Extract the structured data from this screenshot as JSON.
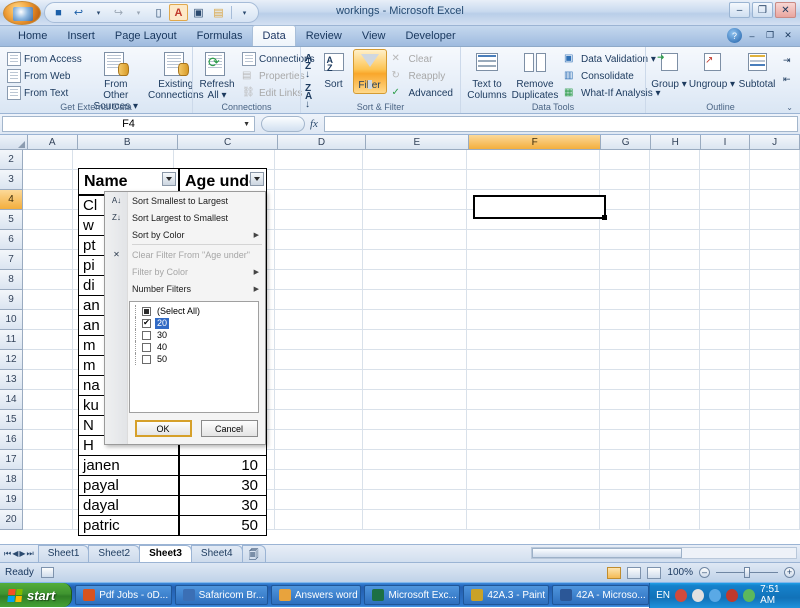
{
  "window": {
    "title": "workings - Microsoft Excel",
    "minimize": "–",
    "restore": "❐",
    "close": "✕",
    "help": "?"
  },
  "quick_access": {
    "office_button": "office-button",
    "items": [
      {
        "name": "save",
        "glyph": "💾"
      },
      {
        "name": "undo",
        "glyph": "↩"
      },
      {
        "name": "redo",
        "glyph": "↪"
      },
      {
        "name": "new",
        "glyph": "🗋"
      },
      {
        "name": "font-color",
        "glyph": "A"
      },
      {
        "name": "print-preview",
        "glyph": "🔍"
      },
      {
        "name": "open",
        "glyph": "📂"
      },
      {
        "name": "customize",
        "glyph": "▾"
      }
    ]
  },
  "ribbon": {
    "tabs": [
      {
        "label": "Home",
        "active": false
      },
      {
        "label": "Insert",
        "active": false
      },
      {
        "label": "Page Layout",
        "active": false
      },
      {
        "label": "Formulas",
        "active": false
      },
      {
        "label": "Data",
        "active": true
      },
      {
        "label": "Review",
        "active": false
      },
      {
        "label": "View",
        "active": false
      },
      {
        "label": "Developer",
        "active": false
      }
    ],
    "groups": [
      {
        "label": "Get External Data",
        "small_items": [
          "From Access",
          "From Web",
          "From Text"
        ],
        "big_items": [
          "From Other Sources ▾",
          "Existing Connections"
        ]
      },
      {
        "label": "Connections",
        "big_items": [
          "Refresh All ▾"
        ],
        "small_items": [
          "Connections",
          "Properties",
          "Edit Links"
        ]
      },
      {
        "label": "Sort & Filter",
        "big_items": [
          "Sort",
          "Filter"
        ],
        "small_items": [
          "Clear",
          "Reapply",
          "Advanced"
        ],
        "sort_az": "A Z",
        "sort_za": "Z A"
      },
      {
        "label": "Data Tools",
        "big_items": [
          "Text to Columns",
          "Remove Duplicates"
        ],
        "small_items": [
          "Data Validation ▾",
          "Consolidate",
          "What-If Analysis ▾"
        ]
      },
      {
        "label": "Outline",
        "big_items": [
          "Group ▾",
          "Ungroup ▾",
          "Subtotal"
        ]
      }
    ]
  },
  "formula_bar": {
    "name_box": "F4",
    "fx_label": "fx",
    "formula": ""
  },
  "grid": {
    "columns": [
      "A",
      "B",
      "C",
      "D",
      "E",
      "F",
      "G",
      "H",
      "I",
      "J"
    ],
    "selected_column": "F",
    "rows": [
      "2",
      "3",
      "4",
      "5",
      "6",
      "7",
      "8",
      "9",
      "10",
      "11",
      "12",
      "13",
      "14",
      "15",
      "16",
      "17",
      "18",
      "19",
      "20"
    ],
    "selected_row": "4",
    "active_cell": "F4",
    "table": {
      "headers": [
        "Name",
        "Age under"
      ],
      "rows": [
        {
          "name": "Cl",
          "age": ""
        },
        {
          "name": "w",
          "age": ""
        },
        {
          "name": "pt",
          "age": ""
        },
        {
          "name": "pi",
          "age": ""
        },
        {
          "name": "di",
          "age": ""
        },
        {
          "name": "an",
          "age": ""
        },
        {
          "name": "an",
          "age": ""
        },
        {
          "name": "m",
          "age": ""
        },
        {
          "name": "m",
          "age": ""
        },
        {
          "name": "na",
          "age": ""
        },
        {
          "name": "ku",
          "age": ""
        },
        {
          "name": "N",
          "age": ""
        },
        {
          "name": "H",
          "age": ""
        },
        {
          "name": "janen",
          "age": "10"
        },
        {
          "name": "payal",
          "age": "30"
        },
        {
          "name": "dayal",
          "age": "30"
        },
        {
          "name": "patric",
          "age": "50"
        }
      ]
    }
  },
  "filter_menu": {
    "items": [
      {
        "label": "Sort Smallest to Largest",
        "icon": "sort-asc-icon",
        "disabled": false,
        "submenu": false
      },
      {
        "label": "Sort Largest to Smallest",
        "icon": "sort-desc-icon",
        "disabled": false,
        "submenu": false
      },
      {
        "label": "Sort by Color",
        "icon": "",
        "disabled": false,
        "submenu": true
      },
      {
        "label": "Clear Filter From \"Age under\"",
        "icon": "clear-filter-icon",
        "disabled": true,
        "submenu": false
      },
      {
        "label": "Filter by Color",
        "icon": "",
        "disabled": true,
        "submenu": true
      },
      {
        "label": "Number Filters",
        "icon": "",
        "disabled": false,
        "submenu": true
      }
    ],
    "checklist": [
      {
        "label": "(Select All)",
        "state": "indeterminate",
        "selected": false
      },
      {
        "label": "20",
        "state": "checked",
        "selected": true
      },
      {
        "label": "30",
        "state": "unchecked",
        "selected": false
      },
      {
        "label": "40",
        "state": "unchecked",
        "selected": false
      },
      {
        "label": "50",
        "state": "unchecked",
        "selected": false
      }
    ],
    "ok_label": "OK",
    "cancel_label": "Cancel"
  },
  "sheet_tabs": {
    "nav": [
      "⏮",
      "◀",
      "▶",
      "⏭"
    ],
    "tabs": [
      {
        "label": "Sheet1",
        "active": false
      },
      {
        "label": "Sheet2",
        "active": false
      },
      {
        "label": "Sheet3",
        "active": true
      },
      {
        "label": "Sheet4",
        "active": false
      }
    ],
    "insert_sheet": "insert-worksheet-icon"
  },
  "status_bar": {
    "state": "Ready",
    "zoom": "100%",
    "zoom_out": "–",
    "zoom_in": "+",
    "views": [
      "normal-view",
      "page-layout-view",
      "page-break-view"
    ]
  },
  "taskbar": {
    "start_label": "start",
    "items": [
      {
        "label": "Pdf Jobs - oD...",
        "color": "#d9531e"
      },
      {
        "label": "Safaricom Br...",
        "color": "#3b6fb5"
      },
      {
        "label": "Answers word",
        "color": "#e8a33d"
      },
      {
        "label": "Microsoft Exc...",
        "color": "#1d7044"
      },
      {
        "label": "42A.3 - Paint",
        "color": "#c9a227"
      },
      {
        "label": "42A - Microso...",
        "color": "#2b5797"
      }
    ],
    "language": "EN",
    "time": "7:51 AM",
    "tray_icons": [
      "help-tray-icon",
      "updates-tray-icon",
      "volume-tray-icon",
      "shield-tray-icon",
      "network-tray-icon"
    ]
  }
}
